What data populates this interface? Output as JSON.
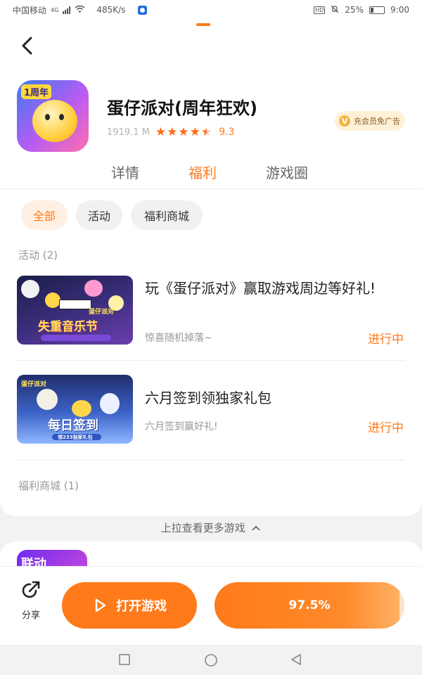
{
  "status_bar": {
    "carrier": "中国移动",
    "network": "4G",
    "speed": "485K/s",
    "battery": "25%",
    "time": "9:00"
  },
  "game": {
    "title": "蛋仔派对(周年狂欢)",
    "size": "1919.1 M",
    "rating_stars": 4.5,
    "score": "9.3",
    "icon_badge": "1周年"
  },
  "vip": {
    "label": "充会员免广告",
    "icon_letter": "V"
  },
  "tabs": [
    "详情",
    "福利",
    "游戏圈"
  ],
  "active_tab": "福利",
  "filters": [
    "全部",
    "活动",
    "福利商城"
  ],
  "active_filter": "全部",
  "sections": {
    "activity_label": "活动 (2)",
    "mall_label": "福利商城 (1)"
  },
  "items": [
    {
      "title": "玩《蛋仔派对》赢取游戏周边等好礼!",
      "subtitle": "惊喜随机掉落~",
      "status": "进行中",
      "image_label": "失重音乐节",
      "image_logo": "蛋仔派对"
    },
    {
      "title": "六月签到领独家礼包",
      "subtitle": "六月签到赢好礼!",
      "status": "进行中",
      "image_label": "每日签到",
      "image_sub": "领233独家礼包",
      "image_logo": "蛋仔派对"
    }
  ],
  "pull_up_hint": "上拉查看更多游戏",
  "next_card": {
    "thumb_label": "联动"
  },
  "bottom": {
    "share_label": "分享",
    "open_label": "打开游戏",
    "progress_label": "97.5%",
    "progress_value": 0.975
  },
  "colors": {
    "accent": "#ff7a1a",
    "accent_light": "#fff0e3",
    "vip_bg": "#fff1d8"
  },
  "icons": {
    "back": "back-arrow-icon",
    "share": "share-icon",
    "play": "play-icon",
    "nav_recent": "square-icon",
    "nav_home": "circle-icon",
    "nav_back": "triangle-back-icon"
  }
}
